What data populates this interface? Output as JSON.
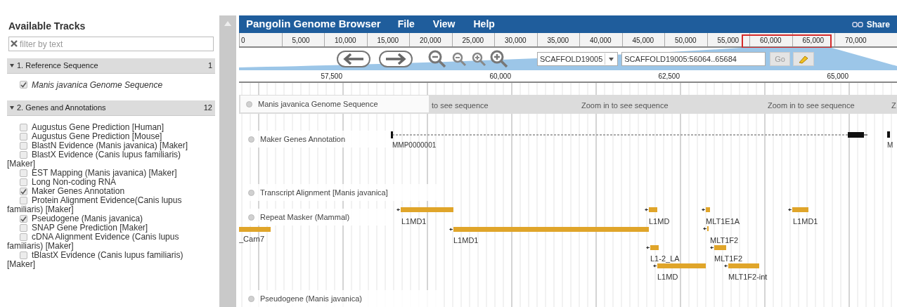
{
  "sidebar": {
    "title": "Available Tracks",
    "filter": {
      "placeholder": "filter by text"
    },
    "categories": [
      {
        "label": "1. Reference Sequence",
        "count": "1",
        "expanded": true,
        "tracks": [
          {
            "label": "Manis javanica Genome Sequence",
            "checked": true
          }
        ]
      },
      {
        "label": "2. Genes and Annotations",
        "count": "12",
        "expanded": true,
        "tracks": [
          {
            "label": "Augustus Gene Prediction [Human]",
            "checked": false
          },
          {
            "label": "Augustus Gene Prediction [Mouse]",
            "checked": false
          },
          {
            "label": "BlastN Evidence (Manis javanica) [Maker]",
            "checked": false
          },
          {
            "label": "BlastX Evidence (Canis lupus familiaris) [Maker]",
            "checked": false
          },
          {
            "label": "EST Mapping (Manis javanica) [Maker]",
            "checked": false
          },
          {
            "label": "Long Non-coding RNA",
            "checked": false
          },
          {
            "label": "Maker Genes Annotation",
            "checked": true
          },
          {
            "label": "Protein Alignment Evidence(Canis lupus familiaris) [Maker]",
            "checked": false
          },
          {
            "label": "Pseudogene (Manis javanica)",
            "checked": true
          },
          {
            "label": "SNAP Gene Prediction [Maker]",
            "checked": false
          },
          {
            "label": "cDNA Alignment Evidence (Canis lupus familiaris) [Maker]",
            "checked": false
          },
          {
            "label": "tBlastX Evidence (Canis lupus familiaris) [Maker]",
            "checked": false
          }
        ]
      }
    ]
  },
  "browser": {
    "title": "Pangolin Genome Browser",
    "menus": [
      "File",
      "View",
      "Help"
    ],
    "share": "Share",
    "overview_ticks": [
      "0",
      "5,000",
      "10,000",
      "15,000",
      "20,000",
      "25,000",
      "30,000",
      "35,000",
      "40,000",
      "45,000",
      "50,000",
      "55,000",
      "60,000",
      "65,000",
      "70,000"
    ],
    "refseq": "SCAFFOLD19005",
    "location": "SCAFFOLD19005:56064..65684",
    "go": "Go",
    "detail_ticks": [
      "57,500",
      "60,000",
      "62,500",
      "65,000"
    ],
    "tracks": [
      {
        "kind": "sequence",
        "label": "Manis javanica Genome Sequence",
        "messages": [
          "to see sequence",
          "Zoom in to see sequence",
          "Zoom in to see sequence",
          "Z"
        ]
      },
      {
        "kind": "genes",
        "label": "Maker Genes Annotation",
        "features": [
          {
            "label": "MMP0000001"
          },
          {
            "label": "M"
          }
        ]
      },
      {
        "kind": "empty",
        "label": "Transcript Alignment [Manis javanica]"
      },
      {
        "kind": "repeats",
        "label": "Repeat Masker (Mammal)",
        "features": [
          {
            "label": "L1MD1"
          },
          {
            "label": "_Carn7"
          },
          {
            "label": "L1MD1"
          },
          {
            "label": "L1MD"
          },
          {
            "label": "MLT1E1A"
          },
          {
            "label": "L1MD1"
          },
          {
            "label": "MLT1F2"
          },
          {
            "label": "L1-2_LA"
          },
          {
            "label": "MLT1F2"
          },
          {
            "label": "L1MD"
          },
          {
            "label": "MLT1F2-int"
          }
        ]
      },
      {
        "kind": "empty",
        "label": "Pseudogene (Manis javanica)"
      }
    ]
  }
}
